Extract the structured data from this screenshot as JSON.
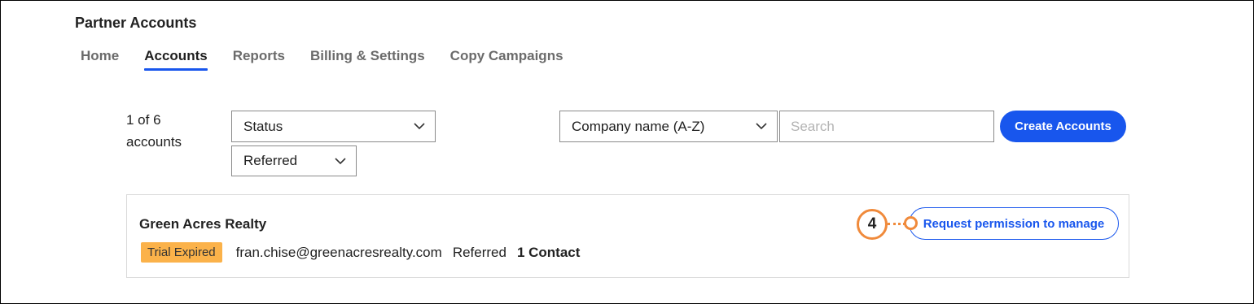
{
  "app": {
    "title": "Partner Accounts"
  },
  "tabs": [
    {
      "label": "Home",
      "active": false
    },
    {
      "label": "Accounts",
      "active": true
    },
    {
      "label": "Reports",
      "active": false
    },
    {
      "label": "Billing & Settings",
      "active": false
    },
    {
      "label": "Copy Campaigns",
      "active": false
    }
  ],
  "toolbar": {
    "count_line1": "1 of 6",
    "count_line2": "accounts",
    "status_filter": "Status",
    "referred_filter": "Referred",
    "sort": "Company name (A-Z)",
    "search_placeholder": "Search",
    "create_label": "Create Accounts"
  },
  "account": {
    "name": "Green Acres Realty",
    "status_badge": "Trial Expired",
    "email": "fran.chise@greenacresrealty.com",
    "type": "Referred",
    "contacts": "1 Contact",
    "action_label": "Request permission to manage"
  },
  "callout": {
    "number": "4"
  },
  "colors": {
    "accent": "#1856ed",
    "badge": "#fbb24a",
    "callout": "#f08a3b"
  }
}
